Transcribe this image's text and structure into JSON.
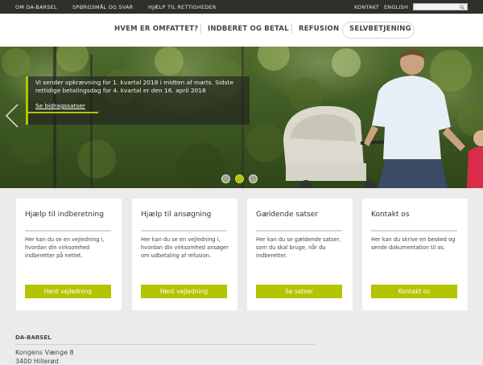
{
  "topbar": {
    "links": [
      "OM DA-BARSEL",
      "SPØRGSMÅL OG SVAR",
      "HJÆLP TIL RETTIGHEDER"
    ],
    "right_links": [
      "KONTAKT",
      "ENGLISH"
    ],
    "search_placeholder": "",
    "search_icon": "search-icon"
  },
  "nav": {
    "items": [
      "HVEM ER OMFATTET?",
      "INDBERET OG BETAL",
      "REFUSION",
      "SELVBETJENING"
    ]
  },
  "hero": {
    "caption": "Vi sender opkrævning for 1. kvartal 2018 i midten af marts. Sidste rettidige betalingsdag for 4. kvartal er den 16. april 2018",
    "link": "Se bidragssatser",
    "slides": 3,
    "active_slide": 2,
    "colors": {
      "accent": "#b4c400"
    }
  },
  "cards": [
    {
      "title": "Hjælp til indberetning",
      "desc": "Her kan du se en vejledning i, hvordan din virksomhed indberetter på nettet.",
      "button": "Hent vejledning"
    },
    {
      "title": "Hjælp til ansøgning",
      "desc": "Her kan du se en vejledning i, hvordan din virksomhed ansøger om udbetaling af refusion.",
      "button": "Hent vejledning"
    },
    {
      "title": "Gældende satser",
      "desc": "Her kan du se gældende satser, som du skal bruge, når du indberetter.",
      "button": "Se satser"
    },
    {
      "title": "Kontakt os",
      "desc": "Her kan du skrive en besked og sende dokumentation til os.",
      "button": "Kontakt os"
    }
  ],
  "footer": {
    "title": "DA-BARSEL",
    "address_line1": "Kongens Vænge 8",
    "address_line2": "3400 Hillerød"
  }
}
